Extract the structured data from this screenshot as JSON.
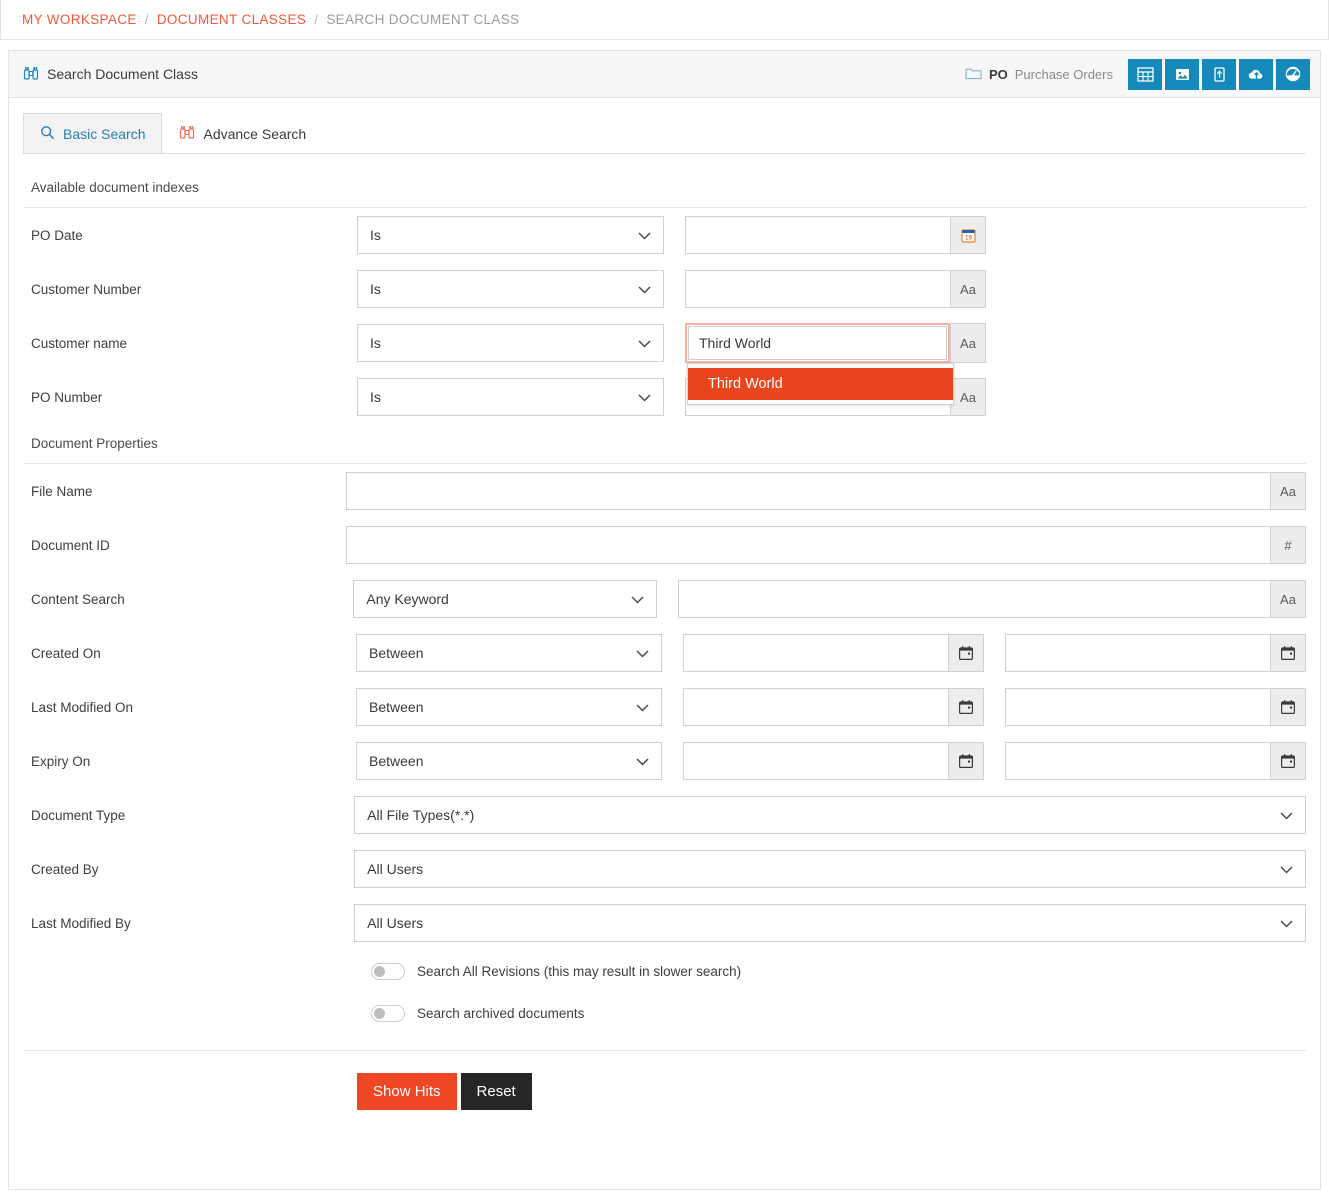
{
  "breadcrumb": {
    "items": [
      {
        "label": "MY WORKSPACE",
        "type": "link"
      },
      {
        "label": "DOCUMENT CLASSES",
        "type": "link"
      },
      {
        "label": "SEARCH DOCUMENT CLASS",
        "type": "current"
      }
    ],
    "separator": "/"
  },
  "panel": {
    "title": "Search Document Class",
    "title_icon": "binoculars-icon",
    "folder": {
      "icon": "folder-icon",
      "code": "PO",
      "name": "Purchase Orders"
    },
    "toolbar_icons": [
      {
        "name": "grid-view-icon",
        "label": "Grid View"
      },
      {
        "name": "image-view-icon",
        "label": "Image View"
      },
      {
        "name": "export-document-icon",
        "label": "Export"
      },
      {
        "name": "cloud-upload-icon",
        "label": "Upload"
      },
      {
        "name": "dashboard-gauge-icon",
        "label": "Dashboard"
      }
    ],
    "accent_color": "#1589b9"
  },
  "tabs": [
    {
      "label": "Basic Search",
      "icon": "magnifier-icon",
      "active": true
    },
    {
      "label": "Advance Search",
      "icon": "binoculars-icon",
      "active": false
    }
  ],
  "sections": {
    "indexes_label": "Available document indexes",
    "properties_label": "Document Properties"
  },
  "document_indexes": [
    {
      "label": "PO Date",
      "operator": "Is",
      "value": "",
      "placeholder": "",
      "addon": "calendar-color-icon",
      "addon_text": ""
    },
    {
      "label": "Customer Number",
      "operator": "Is",
      "value": "",
      "placeholder": "",
      "addon": "text-type-icon",
      "addon_text": "Aa"
    },
    {
      "label": "Customer name",
      "operator": "Is",
      "value": "Third World",
      "placeholder": "",
      "addon": "text-type-icon",
      "addon_text": "Aa",
      "focused": true,
      "autocomplete": [
        "Third World"
      ]
    },
    {
      "label": "PO Number",
      "operator": "Is",
      "value": "",
      "placeholder": "",
      "addon": "text-type-icon",
      "addon_text": "Aa"
    }
  ],
  "document_properties": {
    "file_name": {
      "label": "File Name",
      "value": "",
      "addon_text": "Aa",
      "addon": "text-type-icon"
    },
    "document_id": {
      "label": "Document ID",
      "value": "",
      "addon_text": "#",
      "addon": "number-type-icon"
    },
    "content_search": {
      "label": "Content Search",
      "operator": "Any Keyword",
      "value": "",
      "addon_text": "Aa",
      "addon": "text-type-icon"
    },
    "created_on": {
      "label": "Created On",
      "operator": "Between",
      "from": "",
      "to": "",
      "addon": "calendar-icon"
    },
    "last_modified_on": {
      "label": "Last Modified On",
      "operator": "Between",
      "from": "",
      "to": "",
      "addon": "calendar-icon"
    },
    "expiry_on": {
      "label": "Expiry On",
      "operator": "Between",
      "from": "",
      "to": "",
      "addon": "calendar-icon"
    },
    "document_type": {
      "label": "Document Type",
      "value": "All File Types(*.*)"
    },
    "created_by": {
      "label": "Created By",
      "value": "All Users"
    },
    "last_modified_by": {
      "label": "Last Modified By",
      "value": "All Users"
    }
  },
  "toggles": [
    {
      "label": "Search All Revisions (this may result in slower search)",
      "on": false
    },
    {
      "label": "Search archived documents",
      "on": false
    }
  ],
  "actions": {
    "show_hits": "Show Hits",
    "reset": "Reset",
    "primary_color": "#ef4623",
    "secondary_color": "#262626"
  }
}
